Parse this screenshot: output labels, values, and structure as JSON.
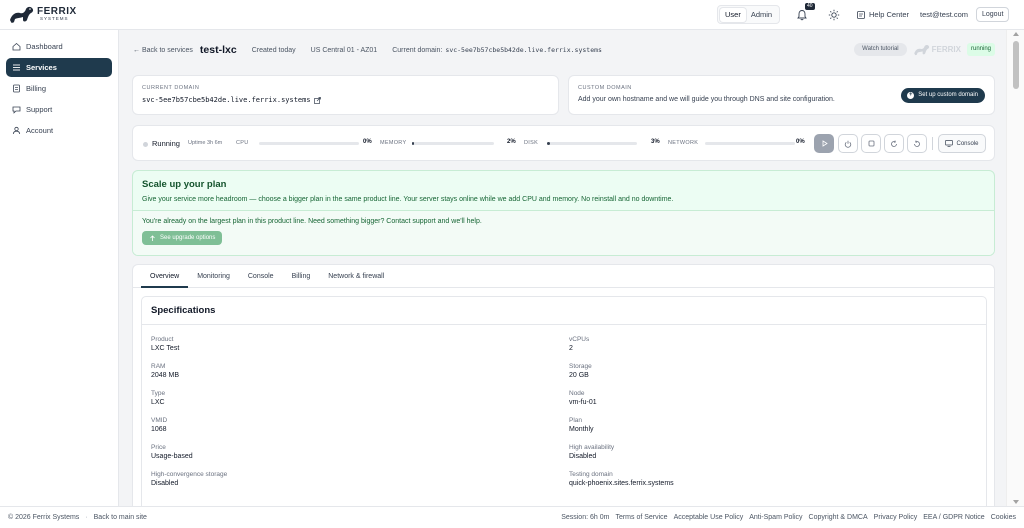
{
  "brand": {
    "name": "FERRIX",
    "sub": "SYSTEMS"
  },
  "topbar": {
    "roles": [
      "User",
      "Admin"
    ],
    "active_role": "User",
    "notifications_count": "40",
    "help_label": "Help Center",
    "user_email": "test@test.com",
    "logout_label": "Logout"
  },
  "sidebar": {
    "items": [
      {
        "label": "Dashboard",
        "icon": "home-icon"
      },
      {
        "label": "Services",
        "icon": "list-icon"
      },
      {
        "label": "Billing",
        "icon": "billing-icon"
      },
      {
        "label": "Support",
        "icon": "chat-icon"
      },
      {
        "label": "Account",
        "icon": "user-icon"
      }
    ],
    "active": "Services"
  },
  "header": {
    "back_label": "← Back to services",
    "service_name": "test-lxc",
    "created": "Created today",
    "region": "US Central 01 - AZ01",
    "current_domain_label": "Current domain:",
    "current_domain": "svc-5ee7b57cbe5b42de.live.ferrix.systems",
    "tutorial_label": "Watch tutorial",
    "ghost_logo": "FERRIX",
    "status": "running"
  },
  "current_domain_card": {
    "label": "CURRENT DOMAIN",
    "value": "svc-5ee7b57cbe5b42de.live.ferrix.systems"
  },
  "custom_domain_card": {
    "label": "CUSTOM DOMAIN",
    "description": "Add your own hostname and we will guide you through DNS and site configuration.",
    "button_label": "Set up custom domain"
  },
  "metrics": {
    "state": "Running",
    "uptime": "Uptime 3h 6m",
    "items": [
      {
        "label": "CPU",
        "percent": 0,
        "display": "0%"
      },
      {
        "label": "MEMORY",
        "percent": 2,
        "display": "2%"
      },
      {
        "label": "DISK",
        "percent": 3,
        "display": "3%"
      },
      {
        "label": "NETWORK",
        "percent": 0,
        "display": "0%"
      }
    ],
    "console_label": "Console"
  },
  "upgrade": {
    "title": "Scale up your plan",
    "description": "Give your service more headroom — choose a bigger plan in the same product line. Your server stays online while we add CPU and memory. No reinstall and no downtime.",
    "note": "You're already on the largest plan in this product line. Need something bigger? Contact support and we'll help.",
    "button_label": "See upgrade options"
  },
  "tabs": [
    "Overview",
    "Monitoring",
    "Console",
    "Billing",
    "Network & firewall"
  ],
  "active_tab": "Overview",
  "specs": {
    "title": "Specifications",
    "rows": [
      {
        "label": "Product",
        "value": "LXC Test"
      },
      {
        "label": "vCPUs",
        "value": "2"
      },
      {
        "label": "RAM",
        "value": "2048 MB"
      },
      {
        "label": "Storage",
        "value": "20 GB"
      },
      {
        "label": "Type",
        "value": "LXC"
      },
      {
        "label": "Node",
        "value": "vm-fu-01"
      },
      {
        "label": "VMID",
        "value": "1068"
      },
      {
        "label": "Plan",
        "value": "Monthly"
      },
      {
        "label": "Price",
        "value": "Usage-based"
      },
      {
        "label": "High availability",
        "value": "Disabled"
      },
      {
        "label": "High-convergence storage",
        "value": "Disabled"
      },
      {
        "label": "Testing domain",
        "value": "quick-phoenix.sites.ferrix.systems"
      }
    ]
  },
  "footer": {
    "copyright": "© 2026 Ferrix Systems",
    "back_to_site": "Back to main site",
    "links": [
      "Session: 6h 0m",
      "Terms of Service",
      "Acceptable Use Policy",
      "Anti-Spam Policy",
      "Copyright & DMCA",
      "Privacy Policy",
      "EEA / GDPR Notice",
      "Cookies"
    ]
  },
  "colors": {
    "accent": "#1f3a4d",
    "success_bg": "#ecfdf3",
    "status_green": "#166534"
  }
}
